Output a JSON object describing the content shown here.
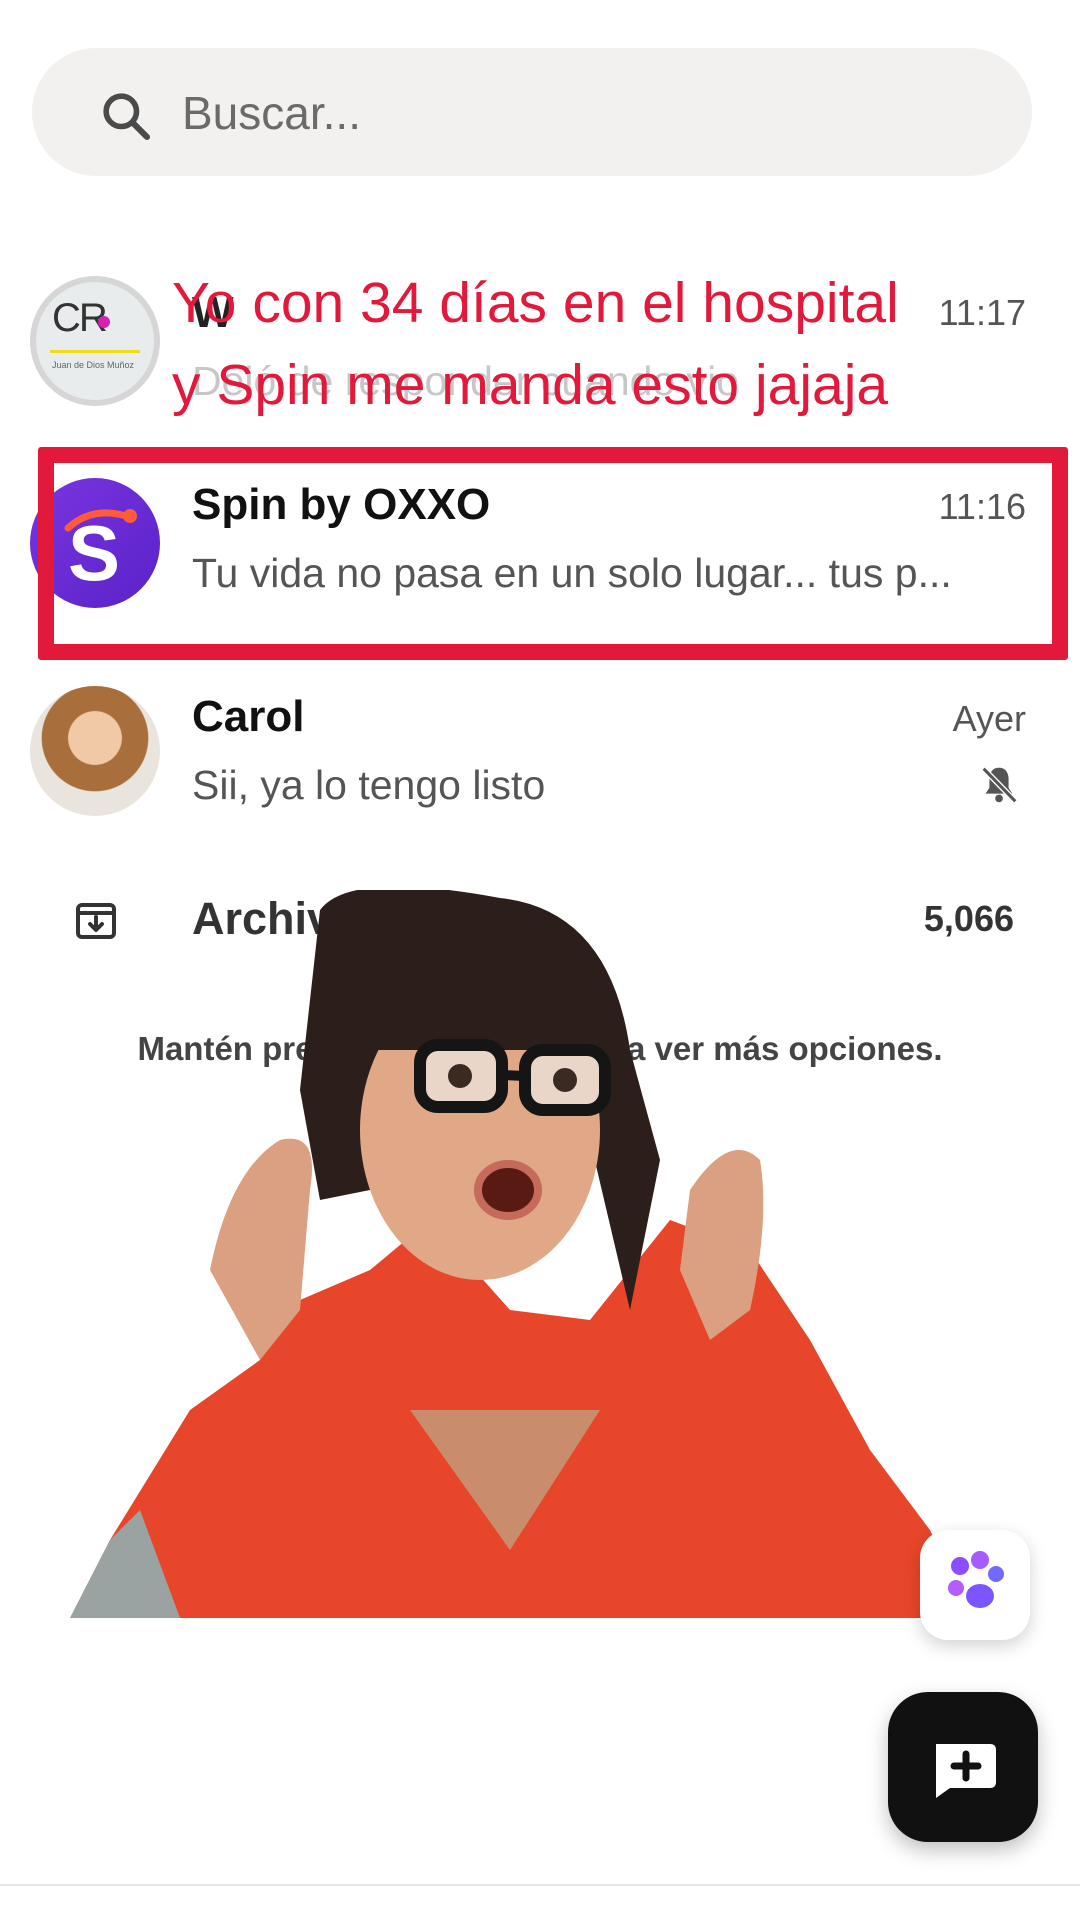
{
  "search": {
    "placeholder": "Buscar..."
  },
  "chats": [
    {
      "name": "W",
      "time": "11:17",
      "preview": "Dejó de responder cuando vio"
    },
    {
      "name": "Spin by OXXO",
      "time": "11:16",
      "preview": "Tu vida no pasa en un solo lugar... tus p..."
    },
    {
      "name": "Carol",
      "time": "Ayer",
      "preview": "Sii, ya lo tengo listo"
    }
  ],
  "first_avatar": {
    "logo_text": "CR",
    "line1": "Juan de Dios Muñoz"
  },
  "spin_avatar": {
    "letter": "S"
  },
  "archived": {
    "label": "Archivados",
    "count": "5,066"
  },
  "hint": "Mantén presionado un chat para ver más opciones.",
  "overlay_caption": {
    "line1": "Yo con 34 días en el hospital",
    "line2": "y Spin me manda esto jajaja"
  },
  "icons": {
    "search": "search-icon",
    "archive": "archive-icon",
    "muted": "muted-bell-icon",
    "ai": "ai-paw-icon",
    "compose": "new-chat-icon"
  },
  "colors": {
    "highlight": "#e3193b",
    "spin_purple": "#6a2fd6",
    "fab": "#111111"
  }
}
